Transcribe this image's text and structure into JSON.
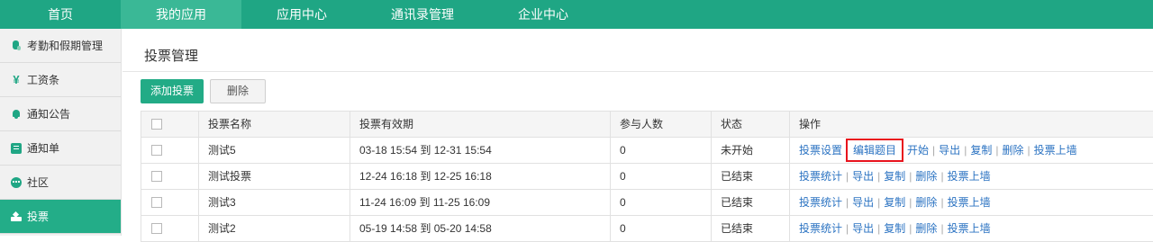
{
  "topnav": [
    {
      "label": "首页"
    },
    {
      "label": "我的应用"
    },
    {
      "label": "应用中心"
    },
    {
      "label": "通讯录管理"
    },
    {
      "label": "企业中心"
    }
  ],
  "sidebar": {
    "items": [
      {
        "label": "考勤和假期管理",
        "icon": "attendance-icon"
      },
      {
        "label": "工资条",
        "icon": "salary-icon"
      },
      {
        "label": "通知公告",
        "icon": "bell-icon"
      },
      {
        "label": "通知单",
        "icon": "list-icon"
      },
      {
        "label": "社区",
        "icon": "chat-icon"
      },
      {
        "label": "投票",
        "icon": "vote-icon"
      }
    ]
  },
  "main": {
    "title": "投票管理",
    "add_button": "添加投票",
    "delete_button": "删除"
  },
  "table": {
    "headers": [
      "",
      "投票名称",
      "投票有效期",
      "参与人数",
      "状态",
      "操作"
    ],
    "rows": [
      {
        "name": "测试5",
        "period": "03-18 15:54 到 12-31 15:54",
        "count": "0",
        "status": "未开始",
        "ops": [
          "投票设置",
          "编辑题目",
          "开始",
          "导出",
          "复制",
          "删除",
          "投票上墙"
        ]
      },
      {
        "name": "测试投票",
        "period": "12-24 16:18 到 12-25 16:18",
        "count": "0",
        "status": "已结束",
        "ops": [
          "投票统计",
          "导出",
          "复制",
          "删除",
          "投票上墙"
        ]
      },
      {
        "name": "测试3",
        "period": "11-24 16:09 到 11-25 16:09",
        "count": "0",
        "status": "已结束",
        "ops": [
          "投票统计",
          "导出",
          "复制",
          "删除",
          "投票上墙"
        ]
      },
      {
        "name": "测试2",
        "period": "05-19 14:58 到 05-20 14:58",
        "count": "0",
        "status": "已结束",
        "ops": [
          "投票统计",
          "导出",
          "复制",
          "删除",
          "投票上墙"
        ]
      }
    ]
  },
  "colors": {
    "brand": "#1fa684",
    "link": "#2b73c2",
    "highlight": "#e8141d"
  }
}
